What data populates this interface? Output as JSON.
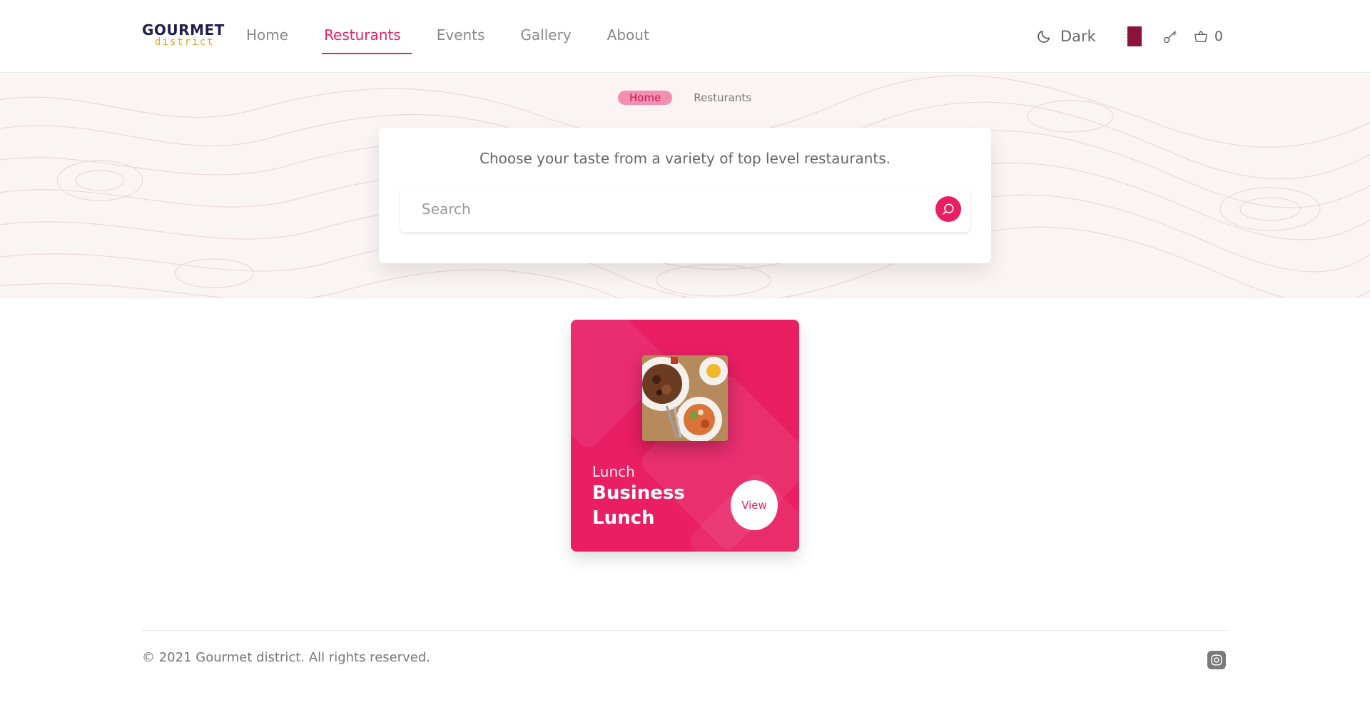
{
  "header": {
    "logo": {
      "top": "GOURMET",
      "bottom": "district"
    },
    "nav": [
      {
        "label": "Home",
        "active": false
      },
      {
        "label": "Resturants",
        "active": true
      },
      {
        "label": "Events",
        "active": false
      },
      {
        "label": "Gallery",
        "active": false
      },
      {
        "label": "About",
        "active": false
      }
    ],
    "theme_toggle_label": "Dark",
    "flag_icon": "qatar-flag-icon",
    "cart_count": "0"
  },
  "hero": {
    "breadcrumb": {
      "home": "Home",
      "current": "Resturants"
    },
    "tagline": "Choose your taste from a variety of top level restaurants.",
    "search_placeholder": "Search"
  },
  "restaurants": [
    {
      "category": "Lunch",
      "title": "Business Lunch",
      "button_label": "View"
    }
  ],
  "footer": {
    "copyright": "© 2021 Gourmet district. All rights reserved.",
    "social_icon": "instagram-icon"
  },
  "colors": {
    "accent": "#e91e63",
    "logo_dark": "#1f1d4e",
    "logo_gold": "#e9a21b",
    "hero_bg": "#fbf4f5"
  }
}
